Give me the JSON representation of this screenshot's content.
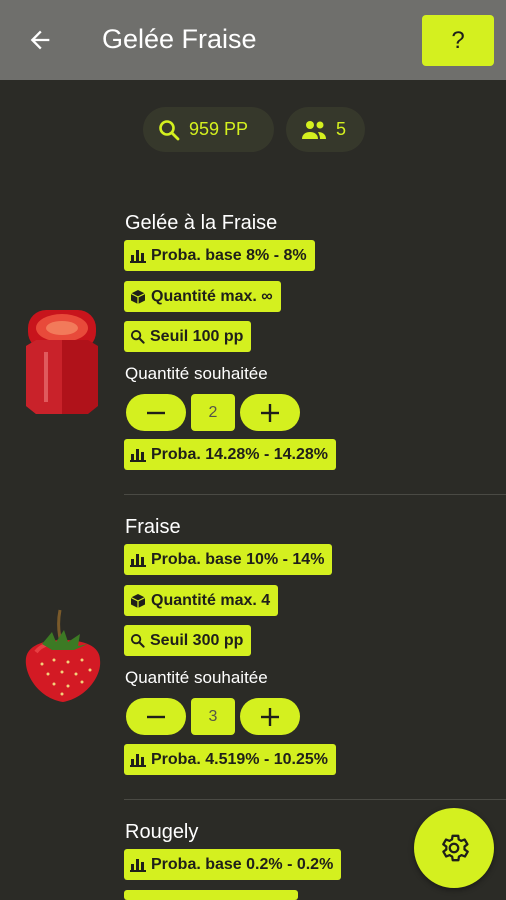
{
  "header": {
    "title": "Gelée Fraise",
    "help_label": "?"
  },
  "summary": {
    "points": "959 PP",
    "players": "5"
  },
  "items": [
    {
      "name": "Gelée à la Fraise",
      "base_proba": "Proba. base 8% - 8%",
      "max_qty": "Quantité max. ∞",
      "threshold": "Seuil 100 pp",
      "wanted_label": "Quantité souhaitée",
      "wanted": "2",
      "proba": "Proba. 14.28% - 14.28%",
      "image": "jam-jar"
    },
    {
      "name": "Fraise",
      "base_proba": "Proba. base 10% - 14%",
      "max_qty": "Quantité max. 4",
      "threshold": "Seuil 300 pp",
      "wanted_label": "Quantité souhaitée",
      "wanted": "3",
      "proba": "Proba. 4.519% - 10.25%",
      "image": "strawberry"
    },
    {
      "name": "Rougely",
      "base_proba": "Proba. base 0.2% - 0.2%"
    }
  ],
  "colors": {
    "accent": "#d4f01f",
    "background": "#2b2b26",
    "appbar": "#6f6f6c"
  },
  "icons": [
    "back-arrow-icon",
    "search-icon",
    "group-icon",
    "bar-chart-icon",
    "cube-icon",
    "minus-icon",
    "plus-icon",
    "gear-icon"
  ]
}
